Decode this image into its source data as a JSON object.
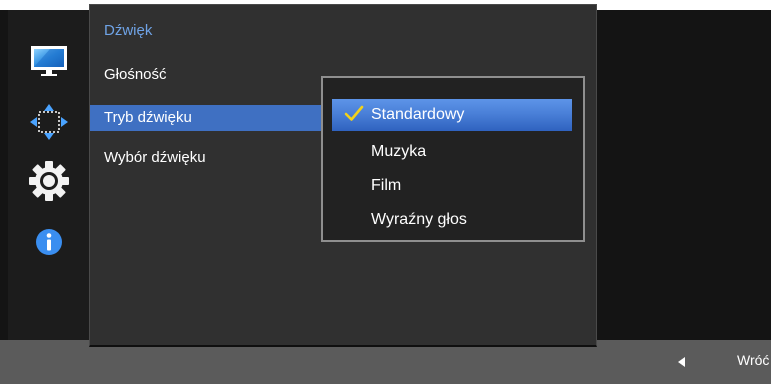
{
  "menu": {
    "title": "Dźwięk",
    "items": [
      {
        "label": "Głośność",
        "selected": false
      },
      {
        "label": "Tryb dźwięku",
        "selected": true
      },
      {
        "label": "Wybór dźwięku",
        "selected": false
      }
    ]
  },
  "submenu": {
    "options": [
      {
        "label": "Standardowy",
        "selected": true
      },
      {
        "label": "Muzyka",
        "selected": false
      },
      {
        "label": "Film",
        "selected": false
      },
      {
        "label": "Wyraźny głos",
        "selected": false
      }
    ]
  },
  "sidebar": {
    "icons": [
      "picture-monitor-icon",
      "position-arrows-icon",
      "settings-gear-icon",
      "information-icon"
    ]
  },
  "footer": {
    "back_label": "Wróć"
  },
  "colors": {
    "accent": "#3f70c2",
    "title": "#6fa3e6",
    "check": "#f2d21a"
  }
}
